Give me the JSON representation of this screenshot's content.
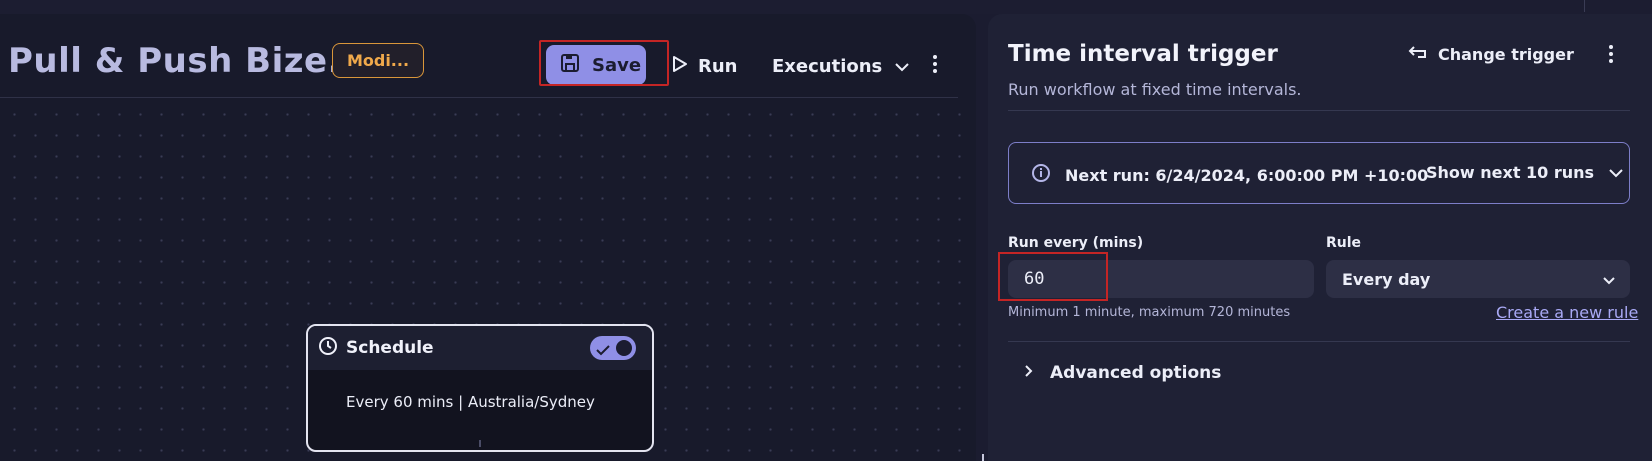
{
  "workflow": {
    "title": "Pull & Push Bize...",
    "status_badge": "Modi...",
    "toolbar": {
      "save_label": "Save",
      "run_label": "Run",
      "executions_label": "Executions"
    }
  },
  "canvas": {
    "node": {
      "title": "Schedule",
      "enabled": true,
      "summary": "Every 60 mins | Australia/Sydney"
    }
  },
  "trigger_panel": {
    "title": "Time interval trigger",
    "subtitle": "Run workflow at fixed time intervals.",
    "change_trigger_label": "Change trigger",
    "next_run": {
      "text": "Next run: 6/24/2024, 6:00:00 PM +10:00",
      "show_next_label": "Show next 10 runs"
    },
    "interval": {
      "label": "Run every (mins)",
      "value": "60",
      "hint": "Minimum 1 minute, maximum 720 minutes"
    },
    "rule": {
      "label": "Rule",
      "selected": "Every day",
      "create_link": "Create a new rule"
    },
    "advanced_label": "Advanced options"
  },
  "colors": {
    "accent": "#8f8fe6",
    "warning": "#f0a94b",
    "highlight": "#c42525"
  }
}
